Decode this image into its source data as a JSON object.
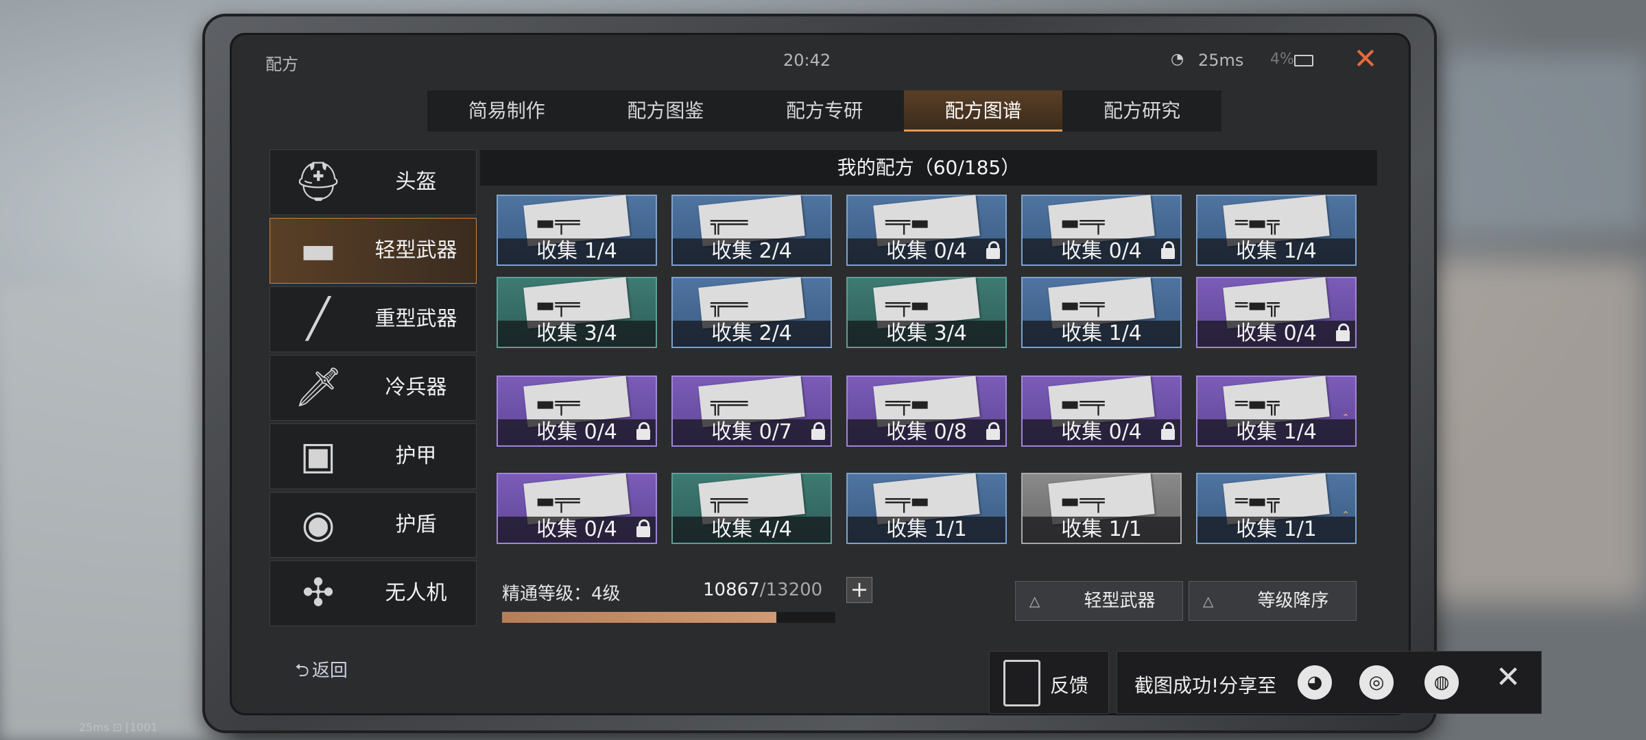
{
  "topbar": {
    "title": "配方",
    "clock": "20:42",
    "ping": "25ms",
    "battery_pct": "4%",
    "close": "✕"
  },
  "tabs": [
    {
      "label": "简易制作"
    },
    {
      "label": "配方图鉴"
    },
    {
      "label": "配方专研"
    },
    {
      "label": "配方图谱",
      "active": true
    },
    {
      "label": "配方研究"
    }
  ],
  "sidebar": [
    {
      "label": "头盔",
      "icon": "helmet-icon",
      "glyph": "⛑"
    },
    {
      "label": "轻型武器",
      "icon": "smg-icon",
      "glyph": "▬",
      "active": true
    },
    {
      "label": "重型武器",
      "icon": "launcher-icon",
      "glyph": "╱"
    },
    {
      "label": "冷兵器",
      "icon": "machete-icon",
      "glyph": "🗡"
    },
    {
      "label": "护甲",
      "icon": "vest-icon",
      "glyph": "▣"
    },
    {
      "label": "护盾",
      "icon": "shield-vest-icon",
      "glyph": "◉"
    },
    {
      "label": "无人机",
      "icon": "drone-icon",
      "glyph": "✣"
    }
  ],
  "back_label": "返回",
  "header": "我的配方（60/185）",
  "cards": [
    {
      "cap": "收集 1/4",
      "color": "blue",
      "lock": false,
      "up": false
    },
    {
      "cap": "收集 2/4",
      "color": "blue",
      "lock": false,
      "up": false
    },
    {
      "cap": "收集 0/4",
      "color": "blue",
      "lock": true,
      "up": false
    },
    {
      "cap": "收集 0/4",
      "color": "blue",
      "lock": true,
      "up": false
    },
    {
      "cap": "收集 1/4",
      "color": "blue",
      "lock": false,
      "up": false
    },
    {
      "cap": "收集 3/4",
      "color": "green",
      "lock": false,
      "up": false
    },
    {
      "cap": "收集 2/4",
      "color": "blue",
      "lock": false,
      "up": false
    },
    {
      "cap": "收集 3/4",
      "color": "green",
      "lock": false,
      "up": false
    },
    {
      "cap": "收集 1/4",
      "color": "blue",
      "lock": false,
      "up": false
    },
    {
      "cap": "收集 0/4",
      "color": "purple",
      "lock": true,
      "up": false
    },
    {
      "cap": "收集 0/4",
      "color": "purple",
      "lock": true,
      "up": false
    },
    {
      "cap": "收集 0/7",
      "color": "purple",
      "lock": true,
      "up": false
    },
    {
      "cap": "收集 0/8",
      "color": "purple",
      "lock": true,
      "up": false
    },
    {
      "cap": "收集 0/4",
      "color": "purple",
      "lock": true,
      "up": false
    },
    {
      "cap": "收集 1/4",
      "color": "purple",
      "lock": false,
      "up": true
    },
    {
      "cap": "收集 0/4",
      "color": "purple",
      "lock": true,
      "up": false
    },
    {
      "cap": "收集 4/4",
      "color": "green",
      "lock": false,
      "up": false
    },
    {
      "cap": "收集 1/1",
      "color": "blue",
      "lock": false,
      "up": false
    },
    {
      "cap": "收集 1/1",
      "color": "gray",
      "lock": false,
      "up": false
    },
    {
      "cap": "收集 1/1",
      "color": "blue",
      "lock": false,
      "up": true
    }
  ],
  "mastery": {
    "label": "精通等级：4级",
    "current": "10867",
    "total": "/13200",
    "progress": 0.823
  },
  "filters": [
    {
      "label": "轻型武器"
    },
    {
      "label": "等级降序"
    }
  ],
  "feedback_label": "反馈",
  "share": {
    "label": "截图成功!分享至",
    "icons": [
      "weibo-icon",
      "wechat-icon",
      "camera-shutter-icon"
    ]
  },
  "debug_text": "25ms ⊡ [1001"
}
